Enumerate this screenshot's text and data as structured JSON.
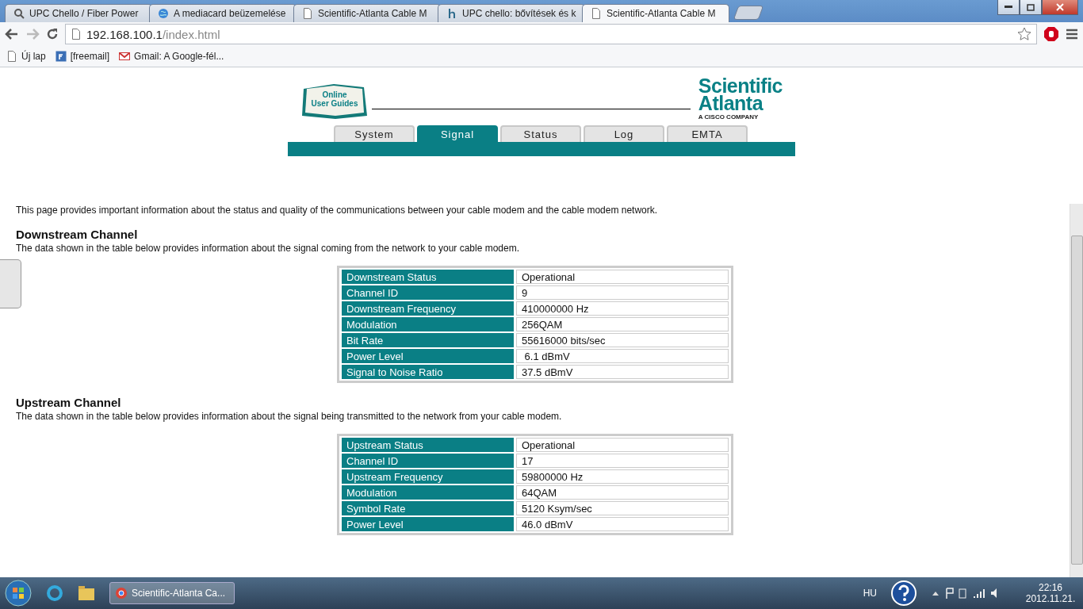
{
  "browser": {
    "tabs": [
      {
        "title": "UPC Chello / Fiber Power",
        "kind": "search",
        "selected": false
      },
      {
        "title": "A mediacard beüzemelése",
        "kind": "globe",
        "selected": false
      },
      {
        "title": "Scientific-Atlanta Cable M",
        "kind": "page",
        "selected": false
      },
      {
        "title": "UPC chello: bővítések és k",
        "kind": "letter",
        "selected": false
      },
      {
        "title": "Scientific-Atlanta Cable M",
        "kind": "page",
        "selected": true
      }
    ],
    "address": {
      "host": "192.168.100.1",
      "path": "/index.html"
    },
    "bookmarks": [
      {
        "label": "Új lap",
        "kind": "page"
      },
      {
        "label": "[freemail]",
        "kind": "f"
      },
      {
        "label": "Gmail: A Google-fél...",
        "kind": "mail"
      }
    ]
  },
  "header": {
    "guide_lines": [
      "Online",
      "User Guides"
    ],
    "brand": [
      "Scientific",
      "Atlanta"
    ],
    "brand_sub": "A CISCO COMPANY",
    "nav_tabs": [
      {
        "label": "System",
        "selected": false
      },
      {
        "label": "Signal",
        "selected": true
      },
      {
        "label": "Status",
        "selected": false
      },
      {
        "label": "Log",
        "selected": false
      },
      {
        "label": "EMTA",
        "selected": false
      }
    ]
  },
  "intro": "This page provides important information about the status and quality of the communications between your cable modem and the cable modem network.",
  "sections": [
    {
      "heading": "Downstream Channel",
      "description": "The data shown in the table below provides information about the signal coming from the network to your cable modem.",
      "rows": [
        {
          "label": "Downstream Status",
          "value": "Operational"
        },
        {
          "label": "Channel ID",
          "value": "9"
        },
        {
          "label": "Downstream Frequency",
          "value": "410000000 Hz"
        },
        {
          "label": "Modulation",
          "value": "256QAM"
        },
        {
          "label": "Bit Rate",
          "value": "55616000 bits/sec"
        },
        {
          "label": "Power Level",
          "value": " 6.1 dBmV"
        },
        {
          "label": "Signal to Noise Ratio",
          "value": "37.5 dBmV"
        }
      ]
    },
    {
      "heading": "Upstream Channel",
      "description": "The data shown in the table below provides information about the signal being transmitted to the network from your cable modem.",
      "rows": [
        {
          "label": "Upstream Status",
          "value": "Operational"
        },
        {
          "label": "Channel ID",
          "value": "17"
        },
        {
          "label": "Upstream Frequency",
          "value": "59800000 Hz"
        },
        {
          "label": "Modulation",
          "value": "64QAM"
        },
        {
          "label": "Symbol Rate",
          "value": "5120 Ksym/sec"
        },
        {
          "label": "Power Level",
          "value": "46.0 dBmV"
        }
      ]
    }
  ],
  "taskbar": {
    "task": "Scientific-Atlanta Ca...",
    "language": "HU",
    "time": "22:16",
    "date": "2012.11.21."
  }
}
